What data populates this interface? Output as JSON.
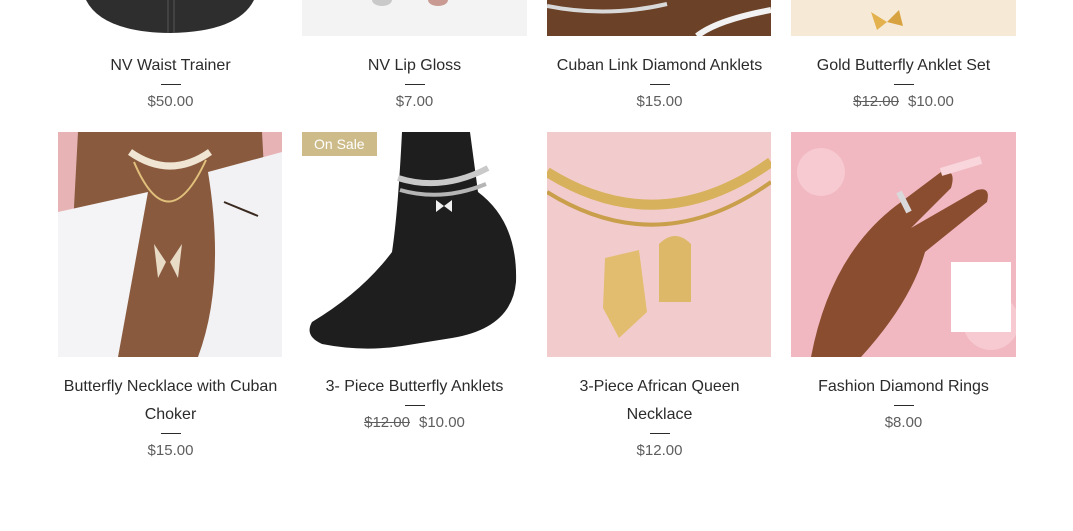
{
  "products_row1": [
    {
      "name": "NV Waist Trainer",
      "price": "$50.00"
    },
    {
      "name": "NV Lip Gloss",
      "price": "$7.00"
    },
    {
      "name": "Cuban Link Diamond Anklets",
      "price": "$15.00"
    },
    {
      "name": "Gold Butterfly Anklet Set",
      "old_price": "$12.00",
      "price": "$10.00"
    }
  ],
  "products_row2": [
    {
      "name": "Butterfly Necklace with Cuban Choker",
      "price": "$15.00"
    },
    {
      "name": "3- Piece Butterfly Anklets",
      "old_price": "$12.00",
      "price": "$10.00",
      "badge": "On Sale"
    },
    {
      "name": "3-Piece African Queen Necklace",
      "price": "$12.00"
    },
    {
      "name": "Fashion Diamond Rings",
      "price": "$8.00"
    }
  ],
  "colors": {
    "text": "#2b2b2b",
    "price": "#5e5e5e",
    "badge_bg": "#cdbb8a",
    "badge_text": "#ffffff"
  }
}
